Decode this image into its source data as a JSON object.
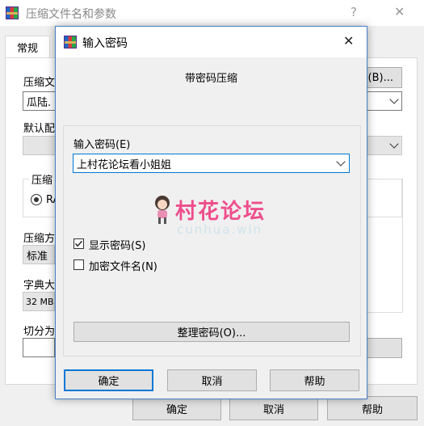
{
  "main_window": {
    "title": "压缩文件名和参数",
    "help_glyph": "?",
    "close_glyph": "✕",
    "tab_general": "常规",
    "archive_name_label": "压缩文",
    "archive_name_value": "瓜陆.",
    "browse_button": "(B)...",
    "default_profile_label": "默认配",
    "format_group_label": "压缩",
    "format_radio_label": "RA",
    "method_label": "压缩方",
    "method_value": "标准",
    "dict_label": "字典大",
    "dict_value": "32 MB",
    "split_label": "切分为",
    "ok_button": "确定",
    "cancel_button": "取消",
    "help_button": "帮助"
  },
  "dialog": {
    "title": "输入密码",
    "close_glyph": "✕",
    "heading": "带密码压缩",
    "password_label": "输入密码(E)",
    "password_value": "上村花论坛看小姐姐",
    "show_password_label": "显示密码(S)",
    "show_password_checked": true,
    "encrypt_names_label": "加密文件名(N)",
    "encrypt_names_checked": false,
    "organize_button": "整理密码(O)...",
    "ok_button": "确定",
    "cancel_button": "取消",
    "help_button": "帮助"
  },
  "watermark": {
    "line1": "村花论坛",
    "line2": "cunhua.win"
  }
}
